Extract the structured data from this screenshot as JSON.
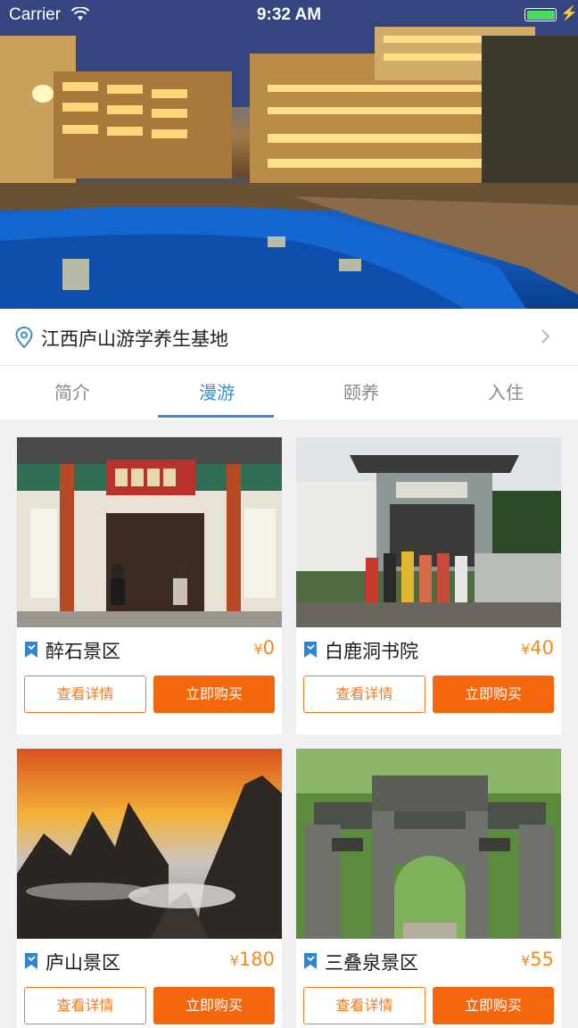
{
  "status_bar": {
    "carrier": "Carrier",
    "time": "9:32 AM"
  },
  "location": {
    "name": "江西庐山游学养生基地"
  },
  "tabs": [
    {
      "label": "简介",
      "active": false
    },
    {
      "label": "漫游",
      "active": true
    },
    {
      "label": "颐养",
      "active": false
    },
    {
      "label": "入住",
      "active": false
    }
  ],
  "spots": [
    {
      "name": "醉石景区",
      "currency": "¥",
      "price": "0",
      "detail_label": "查看详情",
      "buy_label": "立即购买"
    },
    {
      "name": "白鹿洞书院",
      "currency": "¥",
      "price": "40",
      "detail_label": "查看详情",
      "buy_label": "立即购买"
    },
    {
      "name": "庐山景区",
      "currency": "¥",
      "price": "180",
      "detail_label": "查看详情",
      "buy_label": "立即购买"
    },
    {
      "name": "三叠泉景区",
      "currency": "¥",
      "price": "55",
      "detail_label": "查看详情",
      "buy_label": "立即购买"
    }
  ],
  "colors": {
    "accent_blue": "#3a8fd2",
    "accent_orange": "#f5660d",
    "price_orange": "#f28b1a"
  }
}
